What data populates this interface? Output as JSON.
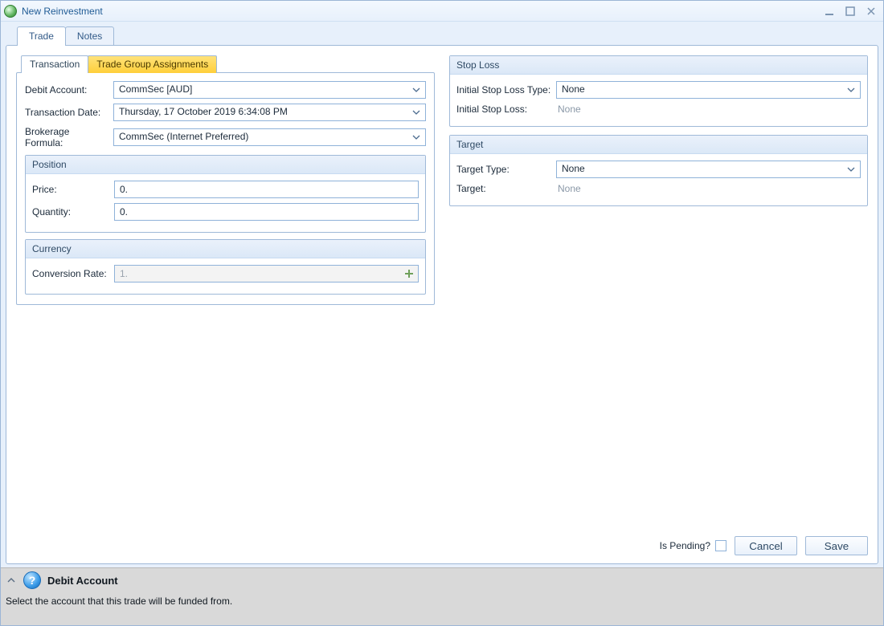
{
  "window": {
    "title": "New Reinvestment"
  },
  "tabs": {
    "trade": "Trade",
    "notes": "Notes"
  },
  "inner_tabs": {
    "transaction": "Transaction",
    "tga": "Trade Group Assignments"
  },
  "transaction": {
    "debit_account_label": "Debit Account:",
    "debit_account_value": "CommSec [AUD]",
    "transaction_date_label": "Transaction Date:",
    "transaction_date_value": "Thursday, 17 October 2019 6:34:08 PM",
    "brokerage_label": "Brokerage Formula:",
    "brokerage_value": "CommSec (Internet Preferred)"
  },
  "position": {
    "header": "Position",
    "price_label": "Price:",
    "price_value": "0.",
    "quantity_label": "Quantity:",
    "quantity_value": "0."
  },
  "currency": {
    "header": "Currency",
    "rate_label": "Conversion Rate:",
    "rate_value": "1."
  },
  "stop_loss": {
    "header": "Stop Loss",
    "type_label": "Initial Stop Loss Type:",
    "type_value": "None",
    "value_label": "Initial Stop Loss:",
    "value_text": "None"
  },
  "target": {
    "header": "Target",
    "type_label": "Target Type:",
    "type_value": "None",
    "value_label": "Target:",
    "value_text": "None"
  },
  "footer": {
    "pending_label": "Is Pending?",
    "cancel": "Cancel",
    "save": "Save"
  },
  "help": {
    "title": "Debit Account",
    "text": "Select the account that this trade will be funded from."
  }
}
